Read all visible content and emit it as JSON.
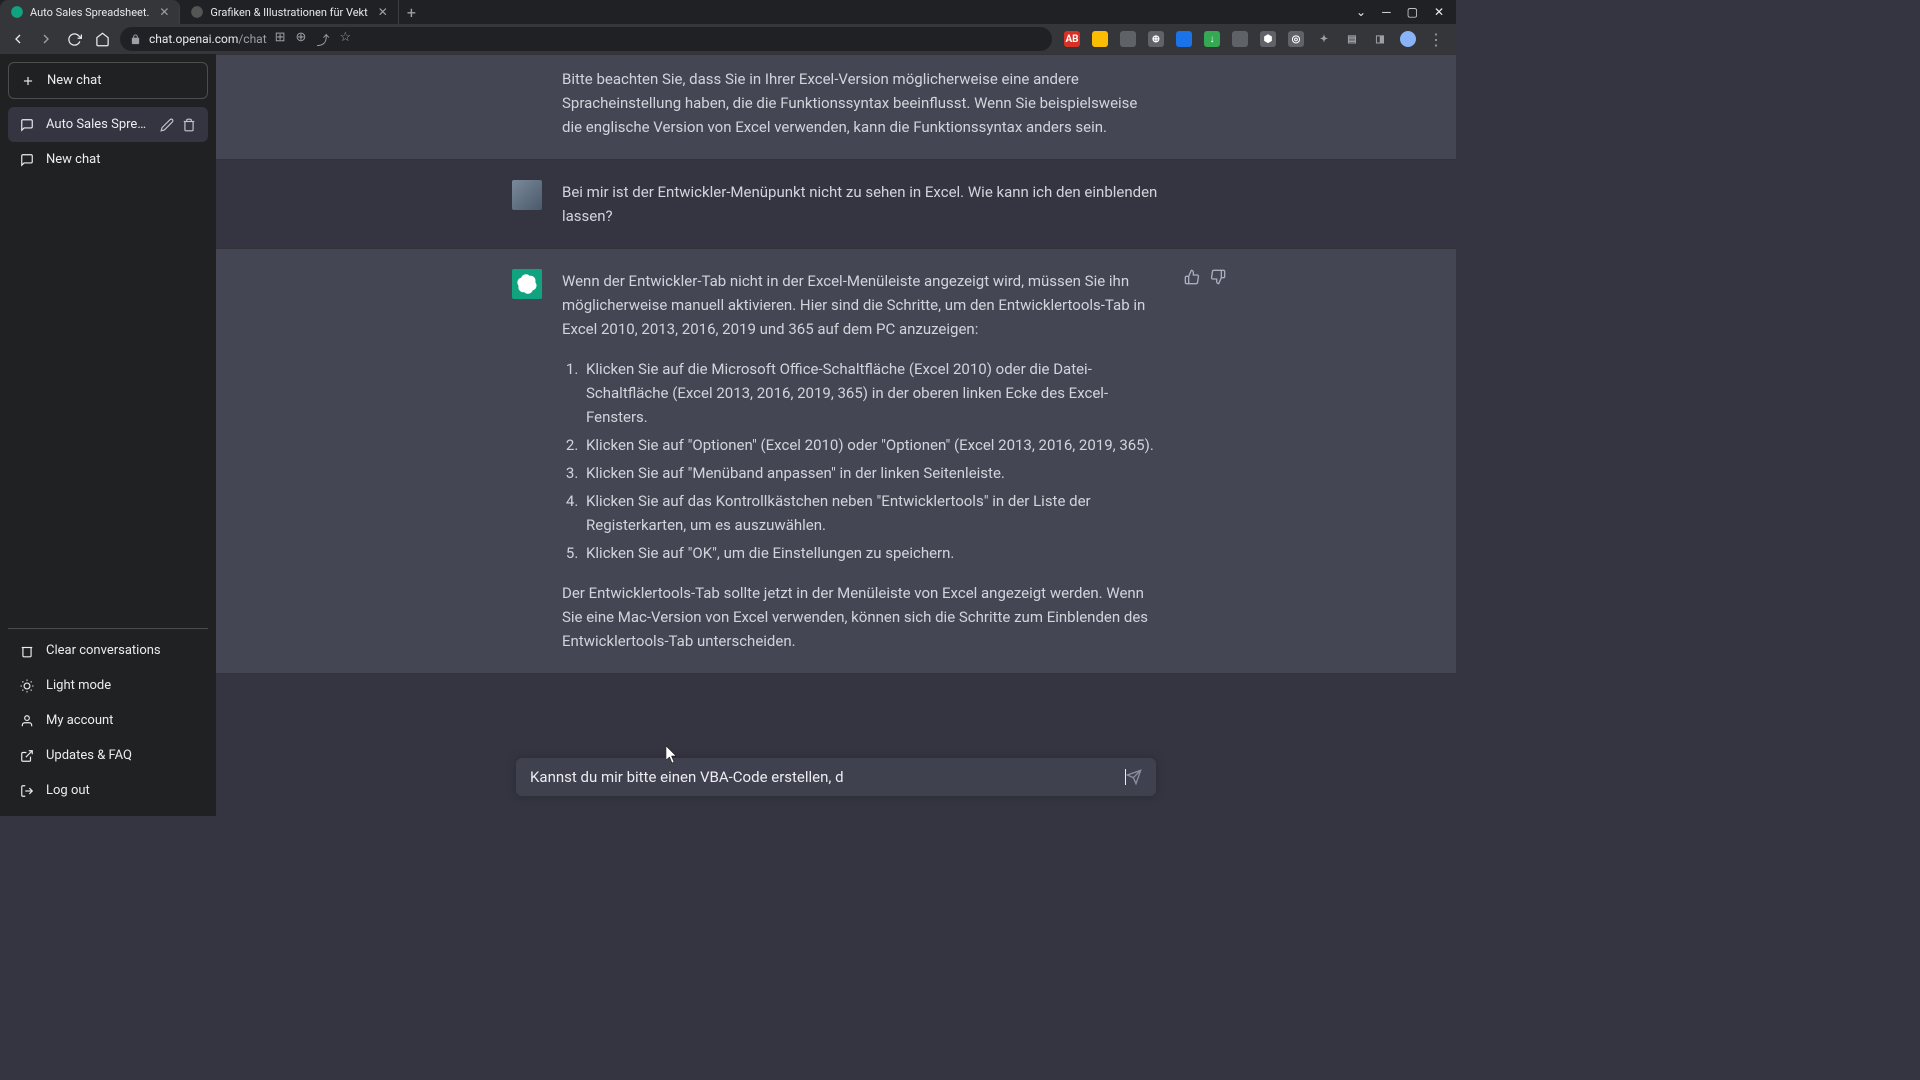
{
  "browser": {
    "tabs": [
      {
        "title": "Auto Sales Spreadsheet."
      },
      {
        "title": "Grafiken & Illustrationen für Vekt"
      }
    ],
    "url_domain": "chat.openai.com",
    "url_path": "/chat"
  },
  "sidebar": {
    "new_chat": "New chat",
    "items": [
      {
        "label": "Auto Sales Spreadshee"
      },
      {
        "label": "New chat"
      }
    ],
    "footer": {
      "clear": "Clear conversations",
      "light": "Light mode",
      "account": "My account",
      "updates": "Updates & FAQ",
      "logout": "Log out"
    }
  },
  "chat": {
    "msg0_p1": "Bitte beachten Sie, dass Sie in Ihrer Excel-Version möglicherweise eine andere Spracheinstellung haben, die die Funktionssyntax beeinflusst. Wenn Sie beispielsweise die englische Version von Excel verwenden, kann die Funktionssyntax anders sein.",
    "msg1": "Bei mir ist der Entwickler-Menüpunkt nicht zu sehen in Excel. Wie kann ich den einblenden lassen?",
    "msg2_p1": "Wenn der Entwickler-Tab nicht in der Excel-Menüleiste angezeigt wird, müssen Sie ihn möglicherweise manuell aktivieren. Hier sind die Schritte, um den Entwicklertools-Tab in Excel 2010, 2013, 2016, 2019 und 365 auf dem PC anzuzeigen:",
    "msg2_li1": "Klicken Sie auf die Microsoft Office-Schaltfläche (Excel 2010) oder die Datei-Schaltfläche (Excel 2013, 2016, 2019, 365) in der oberen linken Ecke des Excel-Fensters.",
    "msg2_li2": "Klicken Sie auf \"Optionen\" (Excel 2010) oder \"Optionen\" (Excel 2013, 2016, 2019, 365).",
    "msg2_li3": "Klicken Sie auf \"Menüband anpassen\" in der linken Seitenleiste.",
    "msg2_li4": "Klicken Sie auf das Kontrollkästchen neben \"Entwicklertools\" in der Liste der Registerkarten, um es auszuwählen.",
    "msg2_li5": "Klicken Sie auf \"OK\", um die Einstellungen zu speichern.",
    "msg2_p2": "Der Entwicklertools-Tab sollte jetzt in der Menüleiste von Excel angezeigt werden. Wenn Sie eine Mac-Version von Excel verwenden, können sich die Schritte zum Einblenden des Entwicklertools-Tab unterscheiden.",
    "input_value": "Kannst du mir bitte einen VBA-Code erstellen, d"
  }
}
